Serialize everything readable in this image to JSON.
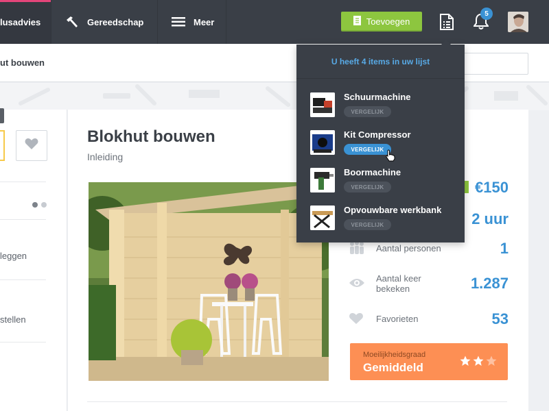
{
  "nav": {
    "items": [
      {
        "label": "lusadvies",
        "icon": "none"
      },
      {
        "label": "Gereedschap",
        "icon": "hammer-icon"
      },
      {
        "label": "Meer",
        "icon": "menu-icon"
      }
    ],
    "add_button": "Toevoegen",
    "notification_count": "5"
  },
  "breadcrumb": "ut bouwen",
  "left_panel": {
    "items": [
      "leggen",
      "stellen"
    ]
  },
  "main": {
    "title": "Blokhut bouwen",
    "subtitle": "Inleiding"
  },
  "stats": {
    "price": "€150",
    "duration": "2 uur",
    "persons_label": "Aantal personen",
    "persons_value": "1",
    "views_label": "Aantal keer bekeken",
    "views_value": "1.287",
    "favorites_label": "Favorieten",
    "favorites_value": "53",
    "difficulty_label": "Moeilijkheidsgraad",
    "difficulty_value": "Gemiddeld",
    "difficulty_stars": 2,
    "difficulty_max": 3
  },
  "compare_list": {
    "header": "U heeft 4 items in uw lijst",
    "button_label": "VERGELIJK",
    "items": [
      {
        "name": "Schuurmachine",
        "active": false
      },
      {
        "name": "Kit Compressor",
        "active": true
      },
      {
        "name": "Boormachine",
        "active": false
      },
      {
        "name": "Opvouwbare werkbank",
        "active": false
      }
    ]
  },
  "colors": {
    "nav_bg": "#3a3f47",
    "accent_green": "#8dc63f",
    "accent_blue": "#3a92d4",
    "accent_orange": "#fd8f54",
    "accent_pink": "#e3457a"
  }
}
